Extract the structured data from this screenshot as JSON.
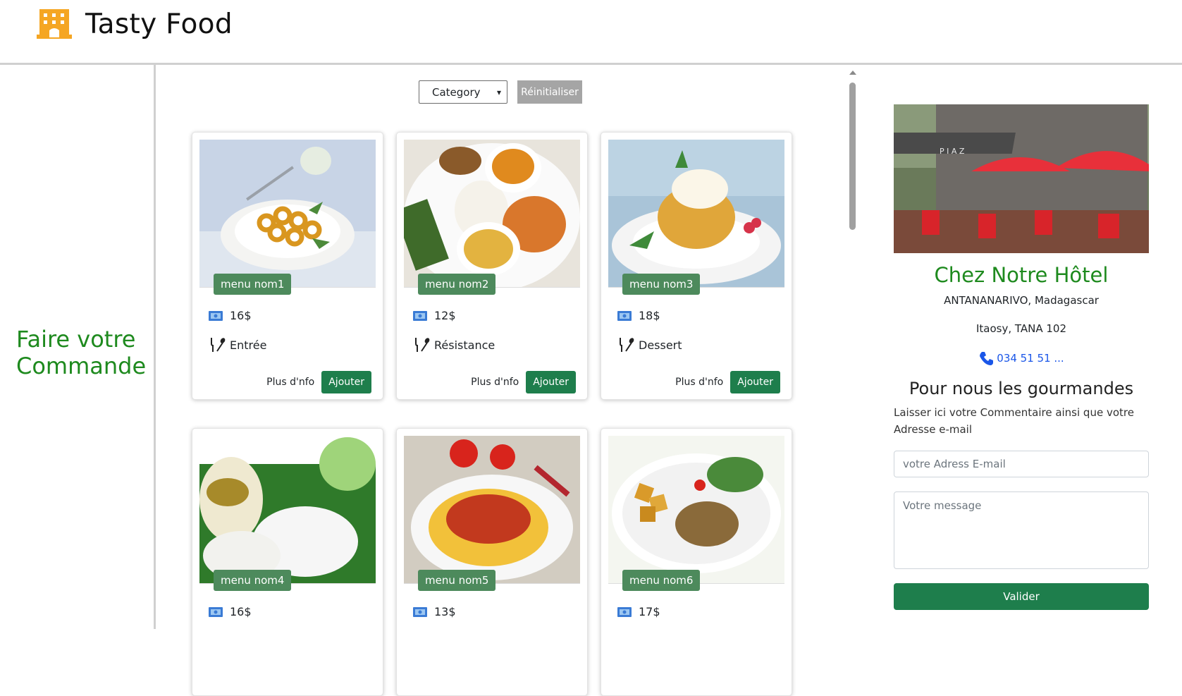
{
  "header": {
    "brand": "Tasty Food",
    "logo_icon": "building-icon",
    "accent": "#f5a623"
  },
  "sidebar": {
    "title": "Faire votre Commande"
  },
  "filter": {
    "select_value": "Category",
    "reset_label": "Réinitialiser"
  },
  "cards": [
    {
      "name": "menu nom1",
      "price": "16$",
      "category": "Entrée",
      "info_label": "Plus d'nfo",
      "add_label": "Ajouter",
      "image": "fried-calamari-plate"
    },
    {
      "name": "menu nom2",
      "price": "12$",
      "category": "Résistance",
      "info_label": "Plus d'nfo",
      "add_label": "Ajouter",
      "image": "rice-curry-plate"
    },
    {
      "name": "menu nom3",
      "price": "18$",
      "category": "Dessert",
      "info_label": "Plus d'nfo",
      "add_label": "Ajouter",
      "image": "pineapple-dessert"
    },
    {
      "name": "menu nom4",
      "price": "16$",
      "category": "",
      "info_label": "",
      "add_label": "",
      "image": "steamed-dumplings-teapot"
    },
    {
      "name": "menu nom5",
      "price": "13$",
      "category": "",
      "info_label": "",
      "add_label": "",
      "image": "polenta-tomato-plate"
    },
    {
      "name": "menu nom6",
      "price": "17$",
      "category": "",
      "info_label": "",
      "add_label": "",
      "image": "roast-chicken-potatoes"
    }
  ],
  "hotel": {
    "name": "Chez Notre Hôtel",
    "address_line1": "ANTANANARIVO, Madagascar",
    "address_line2": "Itaosy, TANA 102",
    "phone": "034 51 51 ...",
    "image": "restaurant-terrace-red-umbrellas"
  },
  "feedback": {
    "title": "Pour nous les gourmandes",
    "description": "Laisser ici votre Commentaire ainsi que votre Adresse e-mail",
    "email_placeholder": "votre Adress E-mail",
    "message_placeholder": "Votre message",
    "submit_label": "Valider"
  },
  "colors": {
    "green_title": "#1e8a1e",
    "button_green": "#1e7e4c",
    "badge_green": "#4d8a5c",
    "link_blue": "#1a56e8"
  }
}
